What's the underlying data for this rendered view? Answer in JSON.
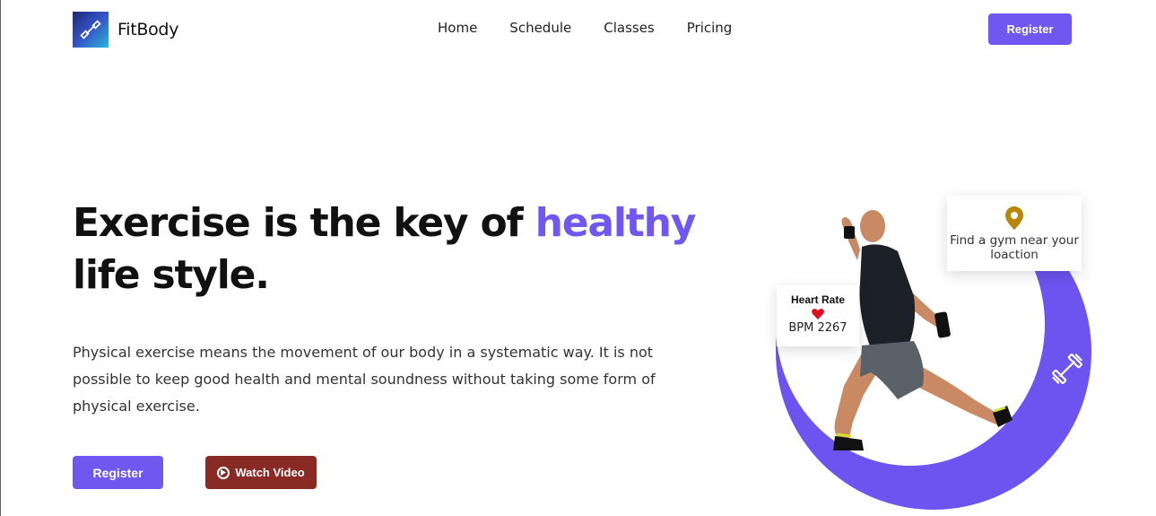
{
  "brand": {
    "name": "FitBody",
    "logo_icon": "dumbbell-icon"
  },
  "nav": {
    "links": [
      "Home",
      "Schedule",
      "Classes",
      "Pricing"
    ],
    "register_label": "Register"
  },
  "hero": {
    "title_part1": "Exercise is the key of ",
    "title_accent": "healthy",
    "title_part2": "life style.",
    "description": "Physical exercise means the movement of our body in a systematic way. It is not possible to keep good health and mental soundness without taking some form of physical exercise.",
    "register_label": "Register",
    "watch_label": "Watch Video"
  },
  "cards": {
    "gym": {
      "icon": "location-pin-icon",
      "text": "Find a gym near your loaction"
    },
    "heart": {
      "title": "Heart Rate",
      "icon": "heart-icon",
      "value": "BPM 2267"
    }
  },
  "colors": {
    "accent": "#7057f0",
    "watch_button": "#8a2a24",
    "pin": "#b8860b",
    "heart": "#e01020"
  }
}
